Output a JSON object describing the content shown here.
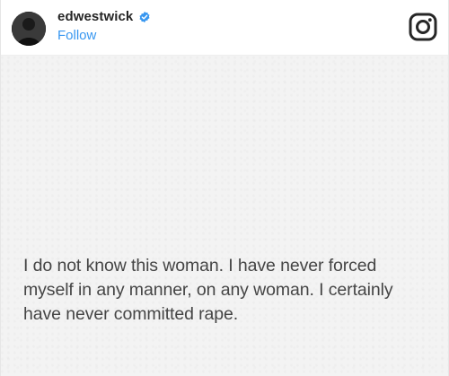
{
  "header": {
    "username": "edwestwick",
    "follow_label": "Follow"
  },
  "icons": {
    "verified": "verified-badge-icon",
    "instagram": "instagram-logo-icon"
  },
  "colors": {
    "follow": "#3897f0",
    "verified": "#3897f0",
    "statement_text": "#454545",
    "photo_background": "#f3f3f3"
  },
  "post": {
    "statement_lines": [
      "I do not know this woman. I have never forced",
      "myself in any manner, on any woman. I certainly",
      "have never committed rape."
    ]
  }
}
